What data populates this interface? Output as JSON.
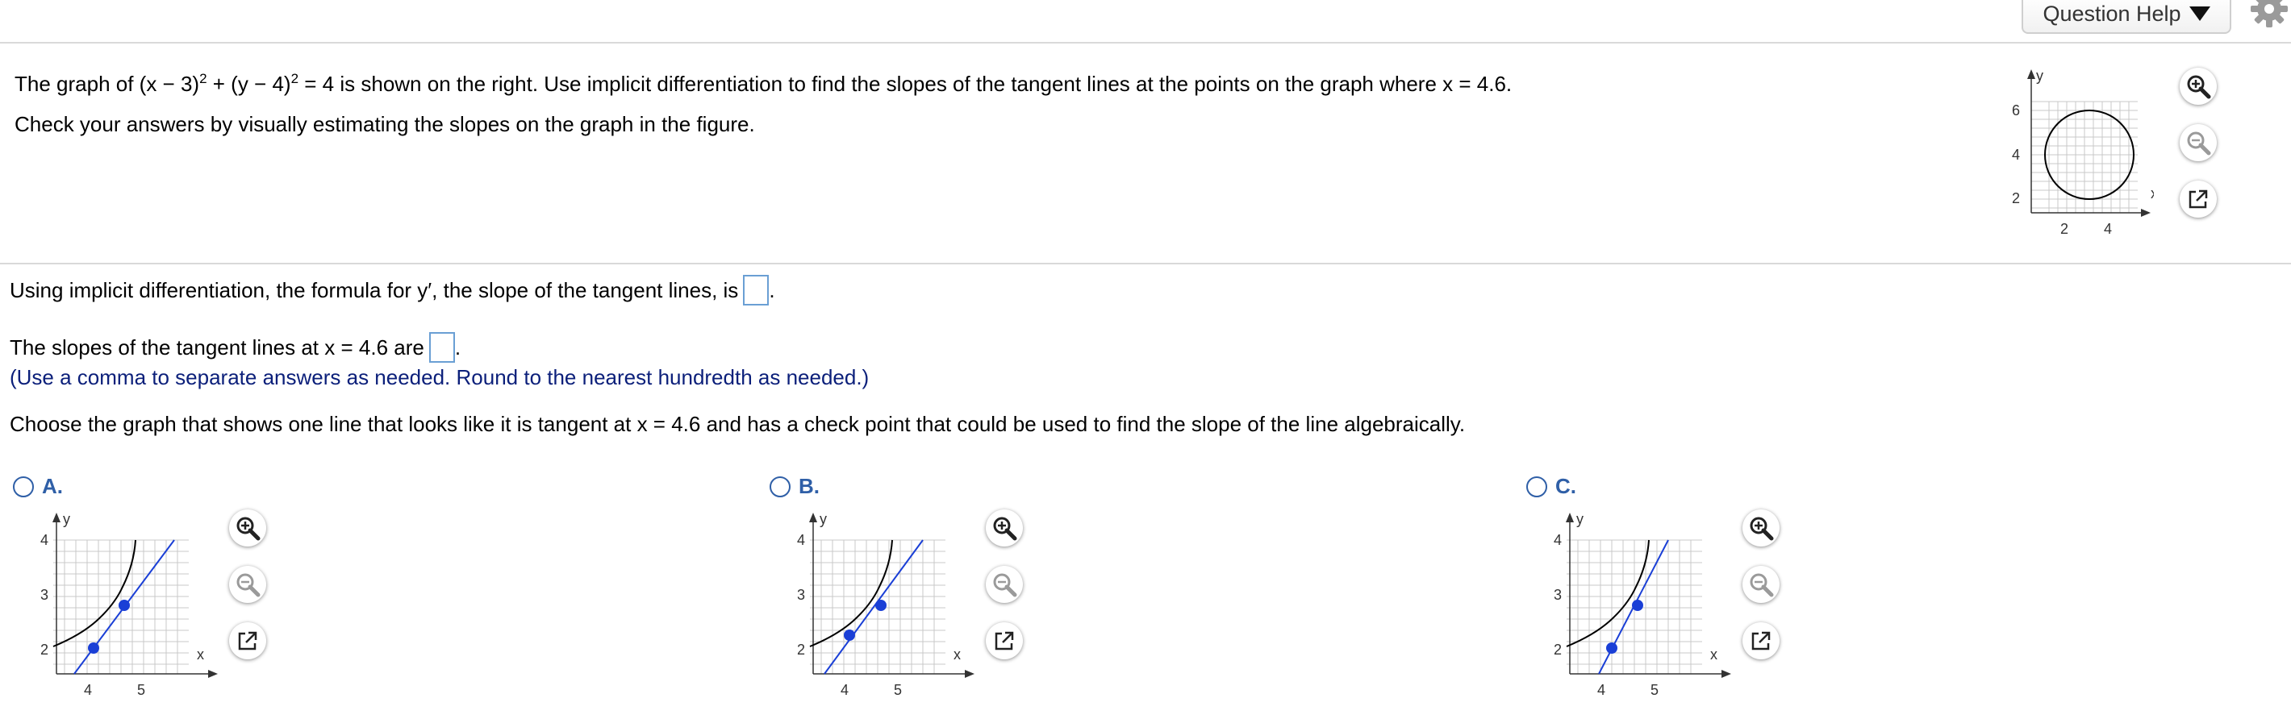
{
  "header": {
    "help_label": "Question Help"
  },
  "question": {
    "equation_prefix": "The graph of (x − 3)",
    "exp1": "2",
    "equation_mid": " + (y − 4)",
    "exp2": "2",
    "equation_suffix": " = 4 is shown on the right.  Use implicit differentiation to find the slopes of the tangent lines at the points on the graph where x = 4.6.",
    "line2": "Check your answers by visually estimating the slopes on the graph in the figure."
  },
  "main_figure": {
    "axis_y": "y",
    "axis_x": "x",
    "yticks": [
      "6",
      "4",
      "2"
    ],
    "xticks": [
      "2",
      "4"
    ]
  },
  "parts": {
    "p1": "Using implicit differentiation, the formula for y′, the slope of the tangent lines, is",
    "p2": "The slopes of the tangent lines at x = 4.6 are",
    "hint": "(Use a comma to separate answers as needed.  Round to the nearest hundredth as needed.)",
    "p3": "Choose the graph that shows one line that looks like it is tangent at x = 4.6 and has a check point that could be used to find the slope of the line algebraically.",
    "period": "."
  },
  "options": [
    {
      "label": "A."
    },
    {
      "label": "B."
    },
    {
      "label": "C."
    }
  ],
  "small_graph": {
    "axis_y": "y",
    "axis_x": "x",
    "yticks": [
      "4",
      "3",
      "2"
    ],
    "xticks": [
      "4",
      "5"
    ]
  },
  "colors": {
    "accent": "#2f5fa7",
    "tangent": "#1a3fd6",
    "hint": "#0b1f7a",
    "box": "#6a9fd4"
  }
}
